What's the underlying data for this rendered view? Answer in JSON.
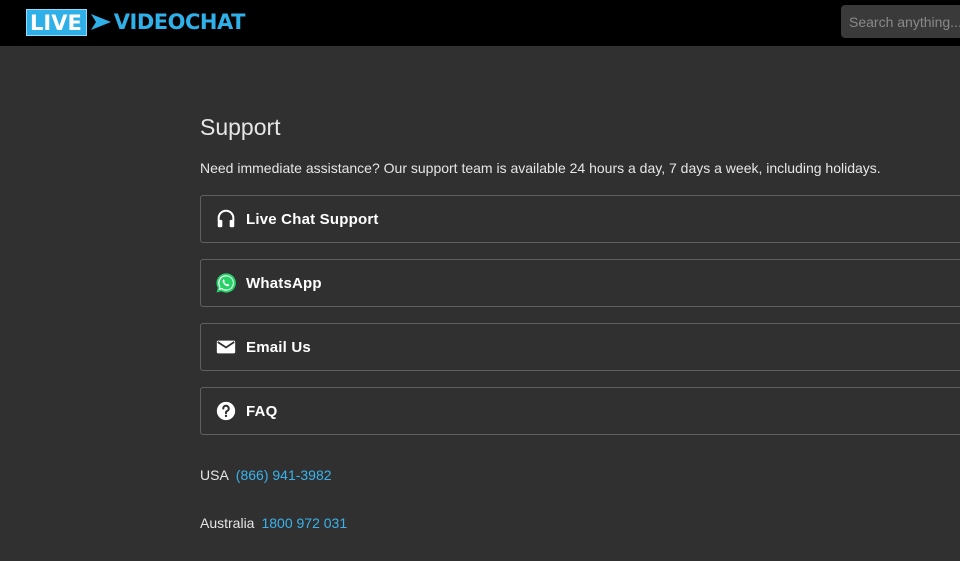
{
  "header": {
    "logo_live": "LIVE",
    "logo_videochat": "VIDEOCHAT",
    "search_placeholder": "Search anything..."
  },
  "support": {
    "title": "Support",
    "lead": "Need immediate assistance? Our support team is available 24 hours a day, 7 days a week, including holidays.",
    "options": [
      {
        "label": "Live Chat Support",
        "icon": "headset-icon"
      },
      {
        "label": "WhatsApp",
        "icon": "whatsapp-icon"
      },
      {
        "label": "Email Us",
        "icon": "email-icon"
      },
      {
        "label": "FAQ",
        "icon": "question-icon"
      }
    ],
    "phones": [
      {
        "country": "USA",
        "number": "(866) 941-3982"
      },
      {
        "country": "Australia",
        "number": "1800 972 031"
      }
    ]
  },
  "colors": {
    "background": "#303030",
    "header": "#000000",
    "brand": "#2fb0e8",
    "link": "#39b3ee",
    "whatsapp": "#25d366"
  }
}
